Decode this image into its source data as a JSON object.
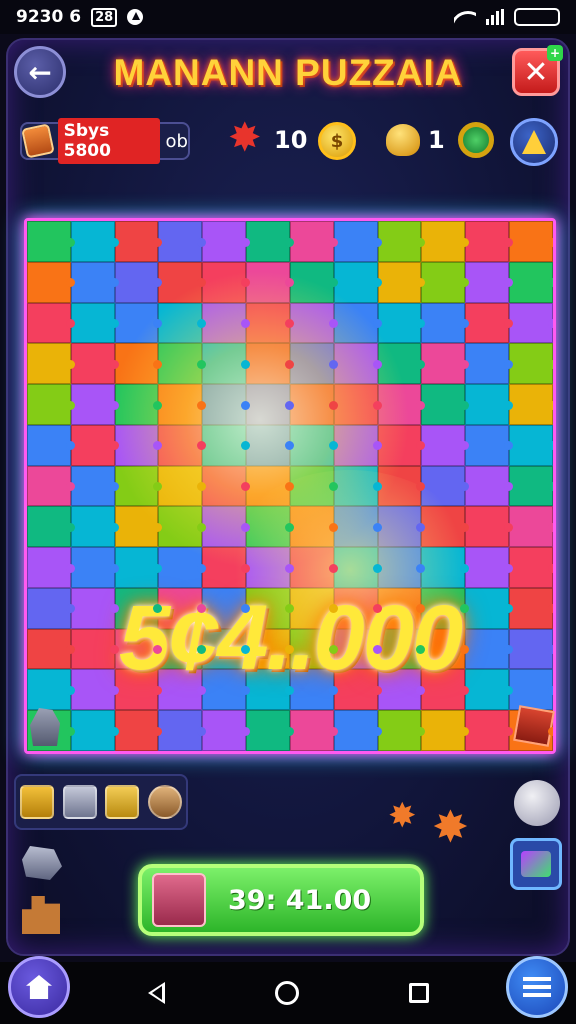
{
  "status_bar": {
    "time": "9230 6",
    "icon_label": "28"
  },
  "header": {
    "title": "MANANN PUZZAIA"
  },
  "hud": {
    "score_label": "Sbys 5800",
    "score_suffix": "ob",
    "stars_count": "10",
    "coin_label": "$",
    "bell_count": "1"
  },
  "board": {
    "big_score": "5¢4..000",
    "piece_colors": [
      "#22c55e",
      "#3b82f6",
      "#ef4444",
      "#eab308",
      "#a855f7",
      "#f97316",
      "#ec4899",
      "#06b6d4",
      "#84cc16",
      "#6366f1",
      "#f43f5e",
      "#10b981"
    ]
  },
  "play_bar": {
    "label": "39: 41.00"
  },
  "colors": {
    "accent": "#ffd23a",
    "board_border": "#ff5af0",
    "play": "#2db52a"
  }
}
